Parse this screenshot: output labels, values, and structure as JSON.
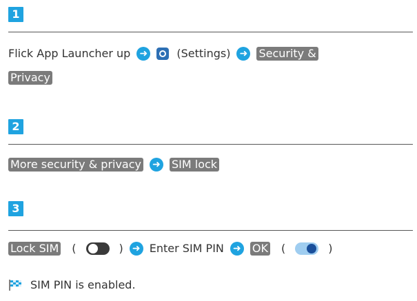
{
  "steps": [
    {
      "number": "1",
      "line1": {
        "text_before": "Flick App Launcher up",
        "settings_label": "(Settings)",
        "key_part1": "Security &"
      },
      "line2": {
        "key_part2": "Privacy"
      }
    },
    {
      "number": "2",
      "key1": "More security & privacy",
      "key2": "SIM lock"
    },
    {
      "number": "3",
      "key1": "Lock SIM",
      "paren_open": "(",
      "paren_close": ")",
      "text_mid": "Enter SIM PIN",
      "key2": "OK",
      "paren_open2": "(",
      "paren_close2": ")"
    }
  ],
  "result": {
    "text": "SIM PIN is enabled."
  },
  "icons": {
    "arrow": "arrow-right-circle-icon",
    "settings": "gear-icon",
    "toggle_off": "toggle-off-icon",
    "toggle_on": "toggle-on-icon",
    "flag": "checkered-flag-icon"
  },
  "colors": {
    "step_badge": "#1fa3e0",
    "key_background": "#7b7b7b",
    "arrow": "#1fa3e0",
    "toggle_on_knob": "#1a4f9b",
    "toggle_on_track": "#9fcdf0",
    "toggle_off_track": "#3a3a3a"
  }
}
